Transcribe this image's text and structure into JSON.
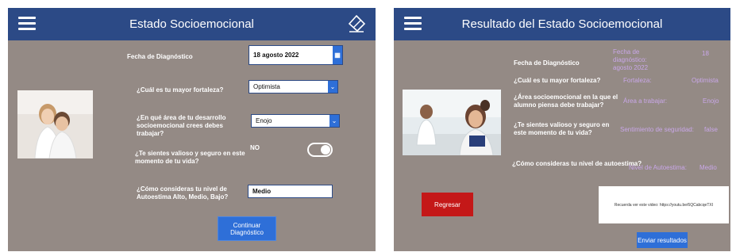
{
  "screen1": {
    "title": "Estado Socioemocional",
    "menu_icon": "hamburger-icon",
    "eraser_icon": "eraser-icon",
    "date_label": "Fecha de Diagnóstico",
    "date_value": "18 agosto 2022",
    "q_strength": "¿Cuál es tu mayor fortaleza?",
    "strength_value": "Optimista",
    "q_area": "¿En qué área de tu desarrollo socioemocional crees debes trabajar?",
    "area_value": "Enojo",
    "q_secure": "¿Te sientes valioso y seguro en este momento de tu vida?",
    "secure_value": "NO",
    "q_selfesteem": "¿Cómo consideras tu nivel de Autoestima Alto, Medio, Bajo?",
    "selfesteem_value": "Medio",
    "continue_button": "Continuar Diagnóstico"
  },
  "screen2": {
    "title": "Resultado del Estado Socioemocional",
    "menu_icon": "hamburger-icon",
    "date_label": "Fecha de Diagnóstico",
    "date_result_label": "Fecha de diagnóstico: agosto 2022",
    "date_result_value": "18",
    "q_strength": "¿Cuál es tu mayor fortaleza?",
    "strength_label": "Fortaleza:",
    "strength_value": "Optimista",
    "q_area": "¿Área socioemocional en la que el alumno piensa debe trabajar?",
    "area_label": "Área a trabajar:",
    "area_value": "Enojo",
    "q_secure": "¿Te sientes valioso y seguro en este momento de tu vida?",
    "secure_label": "Sentimiento de seguridad:",
    "secure_value": "false",
    "q_selfesteem": "¿Cómo consideras tu nivel de autoestima?",
    "selfesteem_label": "Nivel de Autoestima:",
    "selfesteem_value": "Medio",
    "back_button": "Regresar",
    "result_text": "Recuerda ver este video: https://youtu.be/6QCabcqeTXI",
    "send_button": "Enviar resultados"
  },
  "colors": {
    "header": "#2c4a86",
    "background": "#948a85",
    "accent": "#2e6fd8",
    "back_button": "#c41818"
  }
}
